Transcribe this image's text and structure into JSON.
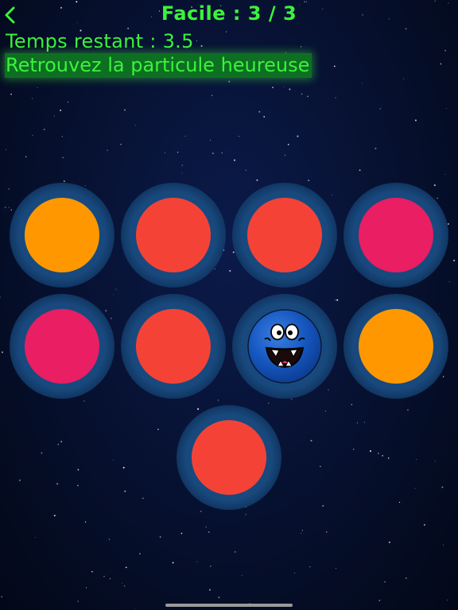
{
  "header": {
    "title": "Facile : 3 / 3",
    "back_icon": "chevron-left-icon"
  },
  "status": {
    "timer_text": "Temps restant : 3.5",
    "instruction": "Retrouvez la particule heureuse"
  },
  "colors": {
    "text_green": "#3cf23c",
    "instruction_bg": "#0d6f22",
    "orange": "#ff9800",
    "red": "#f44336",
    "pink": "#e91e63",
    "blue": "#1565c0"
  },
  "particles": [
    {
      "color": "orange",
      "happy": false
    },
    {
      "color": "red",
      "happy": false
    },
    {
      "color": "red",
      "happy": false
    },
    {
      "color": "pink",
      "happy": false
    },
    {
      "color": "pink",
      "happy": false
    },
    {
      "color": "red",
      "happy": false
    },
    {
      "color": "blue",
      "happy": true
    },
    {
      "color": "orange",
      "happy": false
    },
    {
      "color": "red",
      "happy": false
    }
  ]
}
